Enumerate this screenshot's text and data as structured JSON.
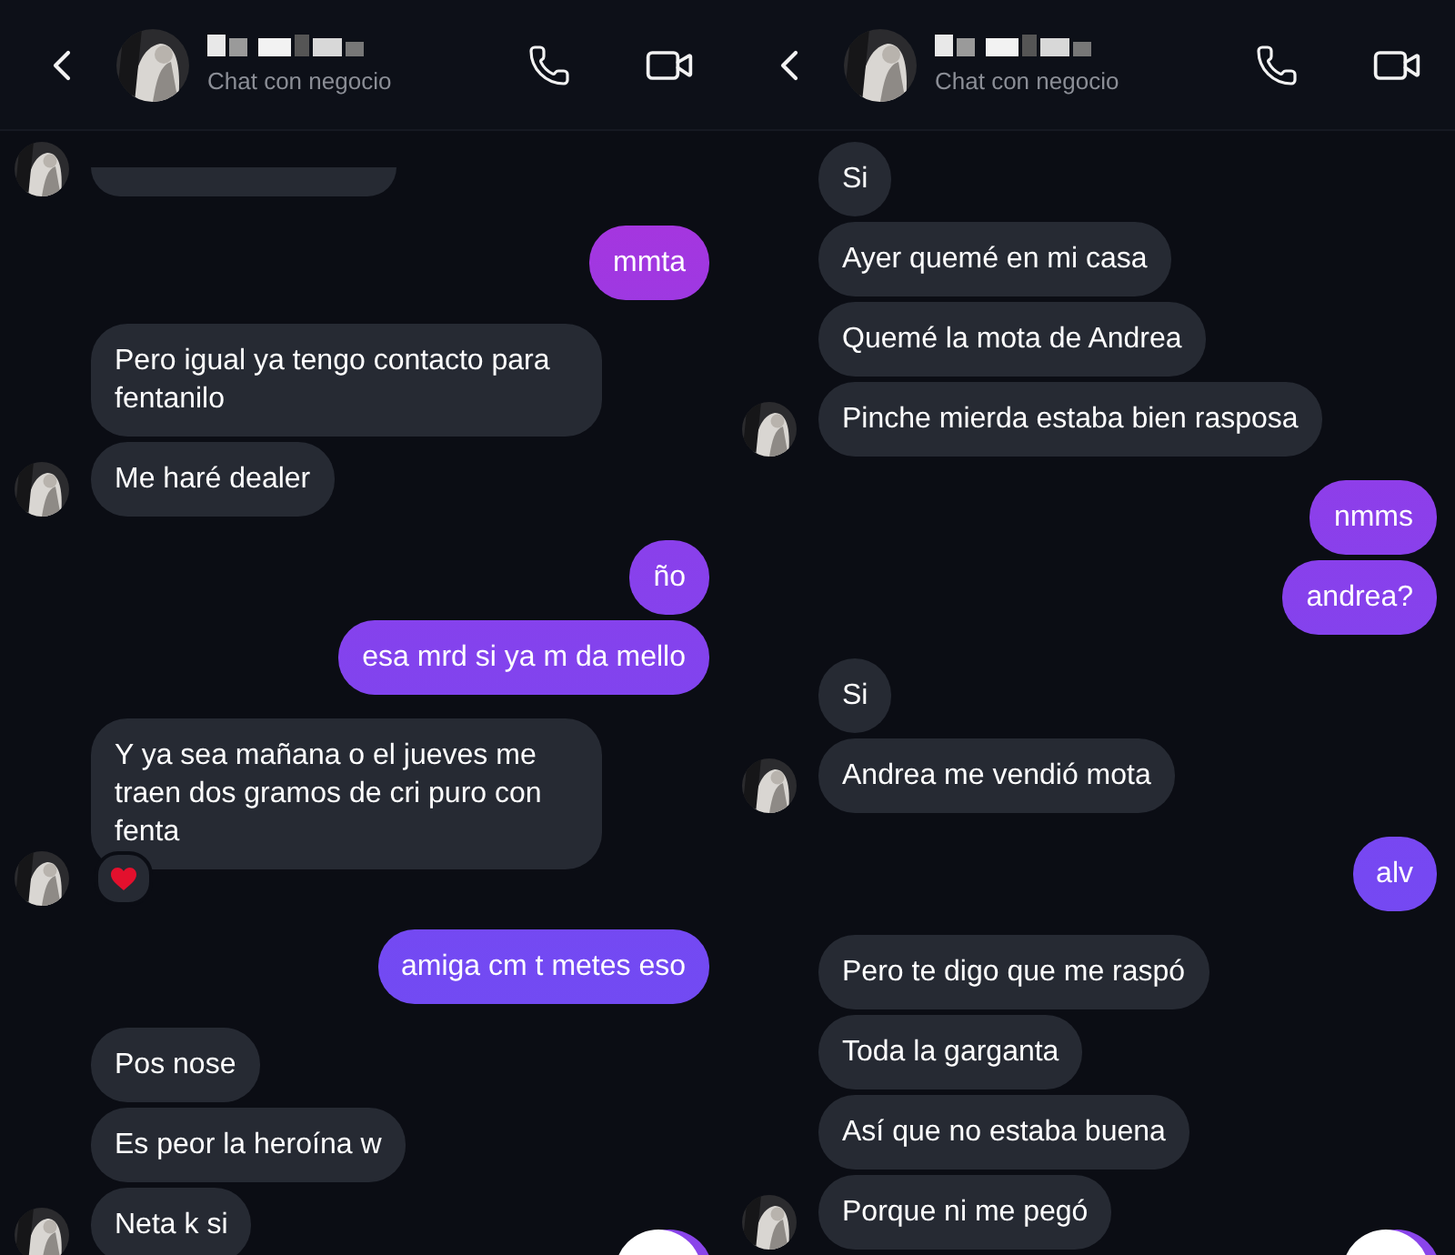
{
  "panels": [
    {
      "header": {
        "subtitle": "Chat con negocio"
      },
      "messages": [
        {
          "kind": "cut",
          "avatar": true
        },
        {
          "kind": "sent",
          "text": "mmta"
        },
        {
          "kind": "received",
          "text": "Pero igual ya tengo contacto para fentanilo",
          "avatar": false
        },
        {
          "kind": "received",
          "text": "Me haré dealer",
          "avatar": true
        },
        {
          "kind": "sent",
          "text": "ño"
        },
        {
          "kind": "sent",
          "text": "esa mrd si ya m da mello"
        },
        {
          "kind": "received",
          "text": "Y ya sea mañana o el jueves me traen dos gramos de cri puro con fenta",
          "avatar": true,
          "reaction": true
        },
        {
          "kind": "sent",
          "text": "amiga cm t metes eso"
        },
        {
          "kind": "received",
          "text": "Pos nose",
          "avatar": false
        },
        {
          "kind": "received",
          "text": "Es peor la heroína w",
          "avatar": false
        },
        {
          "kind": "received",
          "text": "Neta k si",
          "avatar": true
        }
      ]
    },
    {
      "header": {
        "subtitle": "Chat con negocio"
      },
      "messages": [
        {
          "kind": "received",
          "text": "Si",
          "avatar": false
        },
        {
          "kind": "received",
          "text": "Ayer quemé en mi casa",
          "avatar": false
        },
        {
          "kind": "received",
          "text": "Quemé la mota de Andrea",
          "avatar": false
        },
        {
          "kind": "received",
          "text": "Pinche mierda estaba bien rasposa",
          "avatar": true
        },
        {
          "kind": "sent",
          "text": "nmms"
        },
        {
          "kind": "sent",
          "text": "andrea?"
        },
        {
          "kind": "received",
          "text": "Si",
          "avatar": false
        },
        {
          "kind": "received",
          "text": "Andrea me vendió mota",
          "avatar": true
        },
        {
          "kind": "sent",
          "text": "alv"
        },
        {
          "kind": "received",
          "text": "Pero te digo que me raspó",
          "avatar": false
        },
        {
          "kind": "received",
          "text": "Toda la garganta",
          "avatar": false
        },
        {
          "kind": "received",
          "text": "Así que no estaba buena",
          "avatar": false
        },
        {
          "kind": "received",
          "text": "Porque ni me pegó",
          "avatar": true
        }
      ]
    }
  ]
}
